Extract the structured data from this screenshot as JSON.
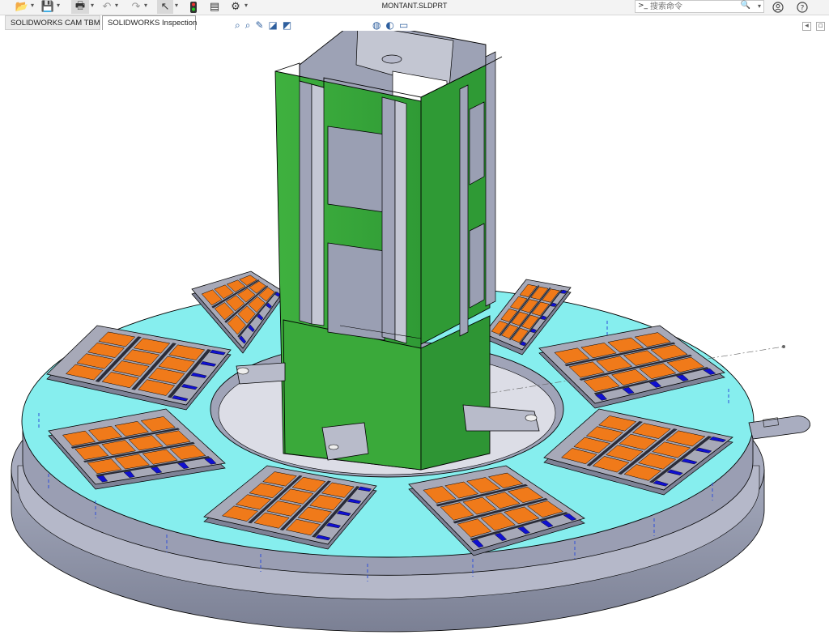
{
  "toolbar": {
    "items": [
      {
        "name": "open-icon",
        "glyph": "📂"
      },
      {
        "name": "save-icon",
        "glyph": "💾"
      },
      {
        "name": "print-icon",
        "glyph": "🖶"
      },
      {
        "name": "undo-icon",
        "glyph": "↶"
      },
      {
        "name": "redo-icon",
        "glyph": "↷"
      },
      {
        "name": "select-icon",
        "glyph": "↖"
      },
      {
        "name": "rebuild-icon",
        "glyph": "🚦"
      },
      {
        "name": "file-properties-icon",
        "glyph": "▤"
      },
      {
        "name": "options-icon",
        "glyph": "⚙"
      }
    ]
  },
  "document": {
    "title": "MONTANT.SLDPRT"
  },
  "search": {
    "placeholder": "搜索命令",
    "prompt_glyph": ">_",
    "magnifier": "🔍",
    "dropdown": "▾"
  },
  "right_icons": {
    "help": "?",
    "user": "◯"
  },
  "tabs": [
    {
      "label": "SOLIDWORKS CAM TBM",
      "active": false
    },
    {
      "label": "SOLIDWORKS Inspection",
      "active": true
    }
  ],
  "colors": {
    "plate_top": "#85f1f1",
    "plate_side": "#9499aa",
    "base_ring": "#8c90a3",
    "pad_orange": "#f07a1a",
    "pad_frame": "#a7a9b8",
    "clamp_blue": "#1010d0",
    "column_green": "#3caa3c",
    "steel_gray": "#a2a6b8"
  }
}
